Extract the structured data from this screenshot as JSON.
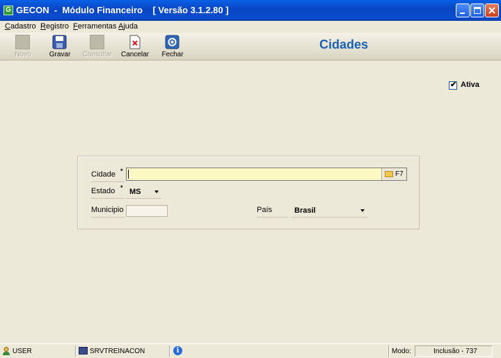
{
  "window": {
    "title": "GECON  -  Módulo Financeiro    [ Versão 3.1.2.80 ]",
    "app_icon_glyph": "G",
    "controls": [
      "minimize-icon",
      "maximize-icon",
      "close-icon"
    ]
  },
  "menu": {
    "items": [
      {
        "first": "C",
        "rest": "adastro"
      },
      {
        "first": "R",
        "rest": "egistro"
      },
      {
        "first": "F",
        "rest": "erramentas"
      },
      {
        "first": "A",
        "rest": "juda"
      }
    ]
  },
  "toolbar": {
    "buttons": [
      {
        "label": "Novo",
        "enabled": false,
        "icon": "new-icon"
      },
      {
        "label": "Gravar",
        "enabled": true,
        "icon": "save-icon"
      },
      {
        "label": "Consultar",
        "enabled": false,
        "icon": "search-icon"
      },
      {
        "label": "Cancelar",
        "enabled": true,
        "icon": "cancel-document-icon"
      },
      {
        "label": "Fechar",
        "enabled": true,
        "icon": "close-power-icon"
      }
    ]
  },
  "page": {
    "title": "Cidades"
  },
  "ativa": {
    "label": "Ativa",
    "checked": true,
    "mark": "✔"
  },
  "form": {
    "required_mark": "*",
    "cidade": {
      "label": "Cidade",
      "value": "",
      "lookup_label": "F7"
    },
    "estado": {
      "label": "Estado",
      "value": "MS"
    },
    "municipio": {
      "label": "Municipio",
      "value": ""
    },
    "pais": {
      "label": "País",
      "value": "Brasil"
    }
  },
  "status": {
    "user": "USER",
    "server": "SRVTREINACON",
    "info_glyph": "i",
    "mode_label": "Modo:",
    "mode_value": "Inclusão - 737"
  },
  "colors": {
    "title_accent": "#1b61b3",
    "input_highlight": "#fdf9c4",
    "titlebar": "#0a4dd1"
  }
}
